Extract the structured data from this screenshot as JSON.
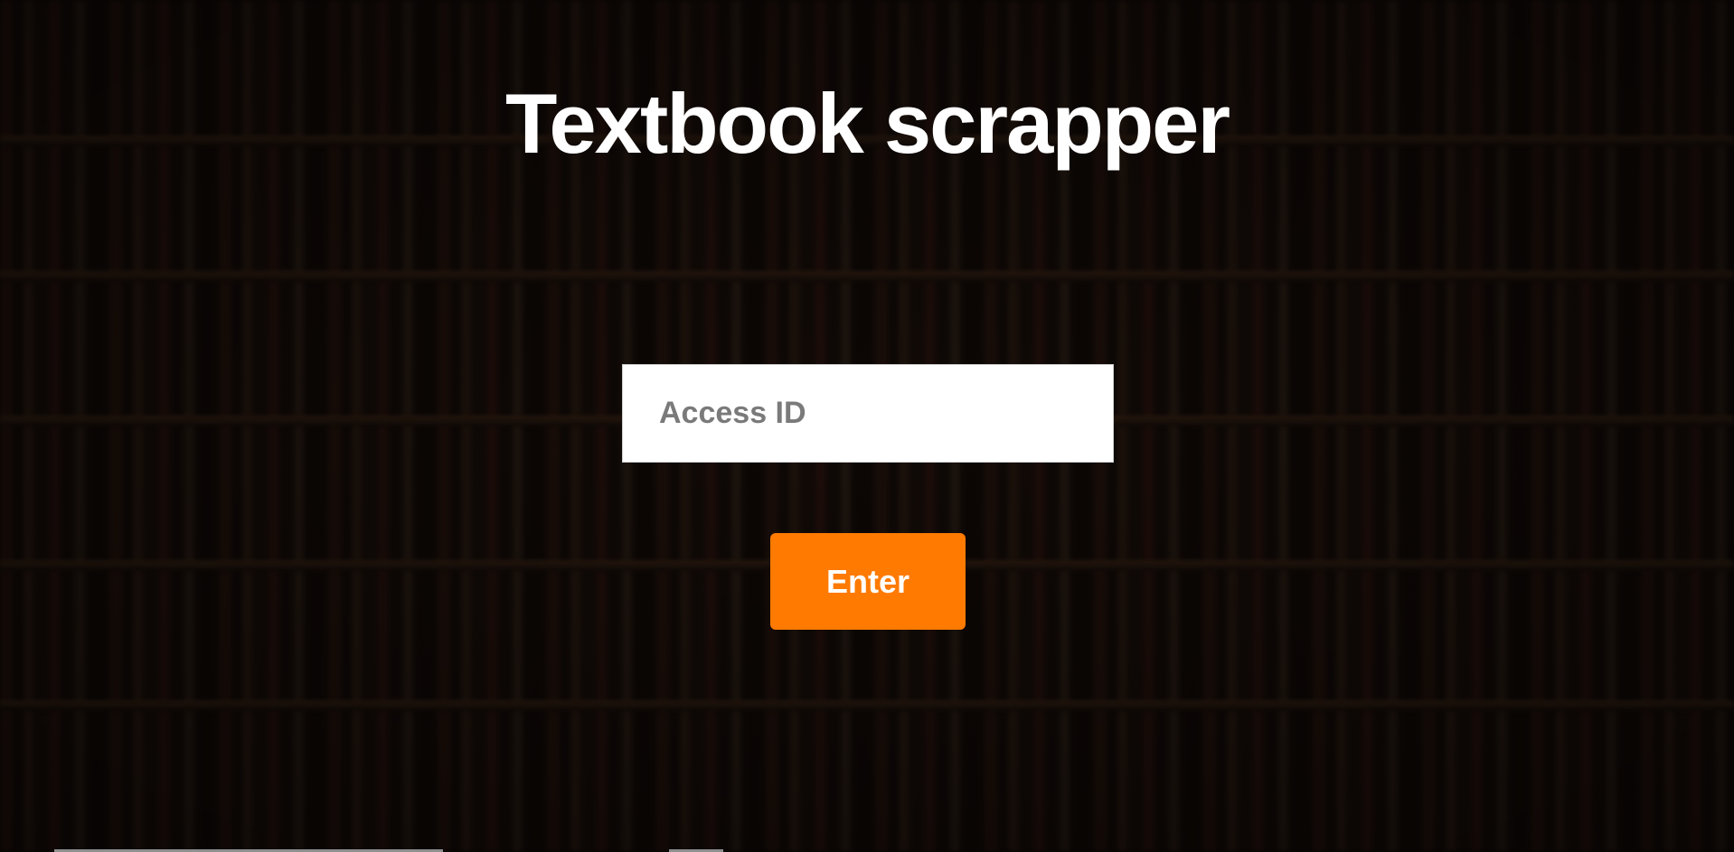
{
  "header": {
    "title": "Textbook scrapper"
  },
  "form": {
    "access_id_placeholder": "Access ID",
    "access_id_value": "",
    "enter_label": "Enter"
  },
  "colors": {
    "accent": "#ff7a00",
    "title_text": "#ffffff",
    "input_background": "#ffffff",
    "placeholder": "#7a7a7a"
  }
}
